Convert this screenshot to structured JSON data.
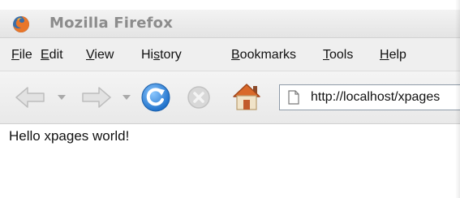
{
  "window": {
    "title": "Mozilla Firefox"
  },
  "menubar": {
    "items": [
      {
        "pre": "",
        "ul": "F",
        "post": "ile"
      },
      {
        "pre": "",
        "ul": "E",
        "post": "dit"
      },
      {
        "pre": "",
        "ul": "V",
        "post": "iew"
      },
      {
        "pre": "Hi",
        "ul": "s",
        "post": "tory"
      },
      {
        "pre": "",
        "ul": "B",
        "post": "ookmarks"
      },
      {
        "pre": "",
        "ul": "T",
        "post": "ools"
      },
      {
        "pre": "",
        "ul": "H",
        "post": "elp"
      }
    ]
  },
  "toolbar": {
    "icons": [
      "back-arrow-icon",
      "dropdown-arrow-icon",
      "forward-arrow-icon",
      "dropdown-arrow-icon",
      "reload-icon",
      "stop-icon",
      "home-icon",
      "page-icon"
    ],
    "url": "http://localhost/xpages"
  },
  "content": {
    "text": "Hello xpages world!"
  },
  "colors": {
    "title_text": "#8c8c8c",
    "reload_blue": "#2a7fd4",
    "home_orange": "#d9692a",
    "urlbar_border": "#8e9aa8"
  }
}
